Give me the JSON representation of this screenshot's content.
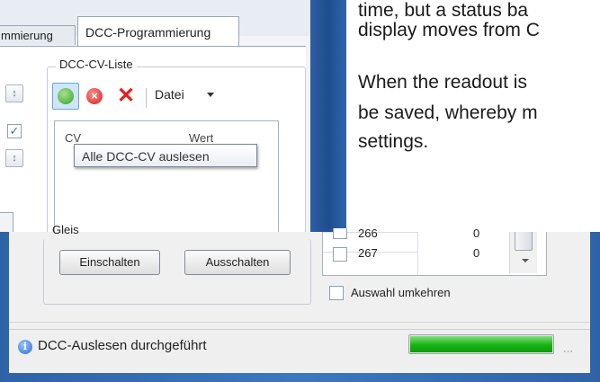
{
  "tabs": {
    "inactive_label": "mmierung",
    "active_label": "DCC-Programmierung"
  },
  "cv_list": {
    "group_title": "DCC-CV-Liste",
    "toolbar": {
      "datei_label": "Datei"
    },
    "header_cv": "CV",
    "header_value": "Wert",
    "tooltip": "Alle DCC-CV auslesen"
  },
  "doc_text": {
    "line1": "time, but a status ba",
    "line2": "display moves from C",
    "line3": "When the readout is",
    "line4": "be saved, whereby m",
    "line5": "settings."
  },
  "gleis": {
    "title": "Gleis",
    "on_label": "Einschalten",
    "off_label": "Ausschalten"
  },
  "cv_rows": [
    {
      "cv": "266",
      "value": "0"
    },
    {
      "cv": "267",
      "value": "0"
    }
  ],
  "invert_selection_label": "Auswahl umkehren",
  "status": {
    "text": "DCC-Auslesen durchgeführt",
    "progress_fraction": 1.0
  },
  "icons": {
    "ok": "check-circle-icon",
    "cancel": "red-x-circle-icon",
    "delete": "red-x-icon",
    "info": "info-icon"
  },
  "colors": {
    "accent_green": "#18b314",
    "window_blue": "#2f63a8",
    "error_red": "#e0231d"
  }
}
